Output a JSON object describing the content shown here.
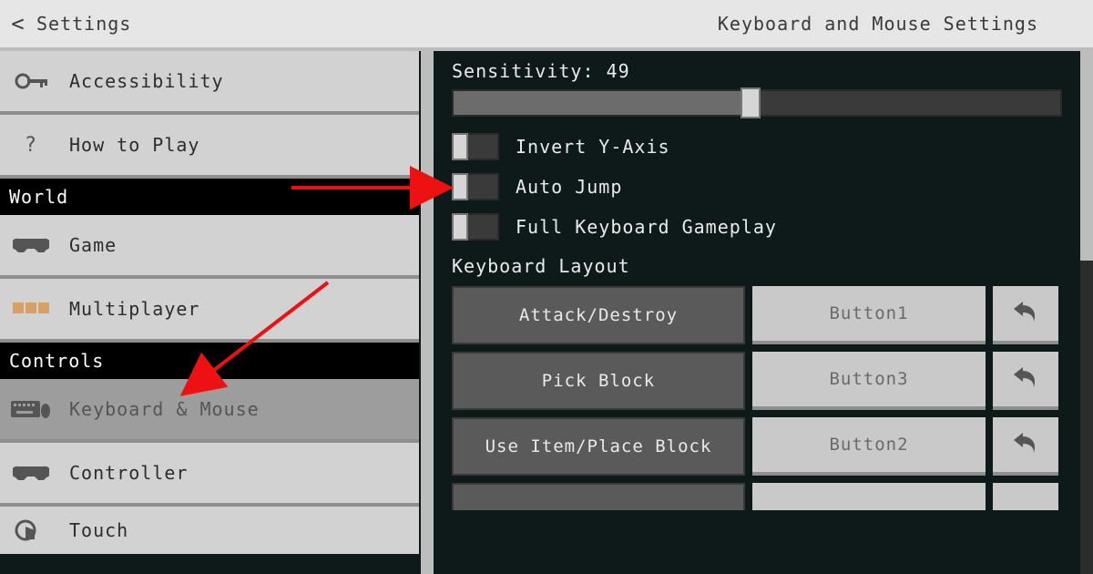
{
  "topbar": {
    "back_glyph": "<",
    "left_title": "Settings",
    "right_title": "Keyboard and Mouse Settings"
  },
  "sidebar": {
    "top_items": [
      {
        "icon": "key-icon",
        "label": "Accessibility"
      },
      {
        "icon": "question-icon",
        "label": "How to Play"
      }
    ],
    "section_world": "World",
    "world_items": [
      {
        "icon": "controller-icon",
        "label": "Game"
      },
      {
        "icon": "people-icon",
        "label": "Multiplayer"
      }
    ],
    "section_controls": "Controls",
    "controls_items": [
      {
        "icon": "keyboard-icon",
        "label": "Keyboard & Mouse",
        "selected": true
      },
      {
        "icon": "controller-icon",
        "label": "Controller"
      },
      {
        "icon": "touch-icon",
        "label": "Touch"
      }
    ]
  },
  "panel": {
    "sensitivity_label": "Sensitivity: 49",
    "sensitivity_value": 49,
    "toggles": [
      {
        "label": "Invert Y-Axis",
        "on": false
      },
      {
        "label": "Auto Jump",
        "on": false
      },
      {
        "label": "Full Keyboard Gameplay",
        "on": false
      }
    ],
    "keyboard_layout_heading": "Keyboard Layout",
    "bindings": [
      {
        "action": "Attack/Destroy",
        "button": "Button1"
      },
      {
        "action": "Pick Block",
        "button": "Button3"
      },
      {
        "action": "Use Item/Place Block",
        "button": "Button2"
      }
    ]
  },
  "annotations": {
    "arrow1": "points from sidebar area to Auto Jump toggle",
    "arrow2": "points to Keyboard & Mouse sidebar item"
  }
}
